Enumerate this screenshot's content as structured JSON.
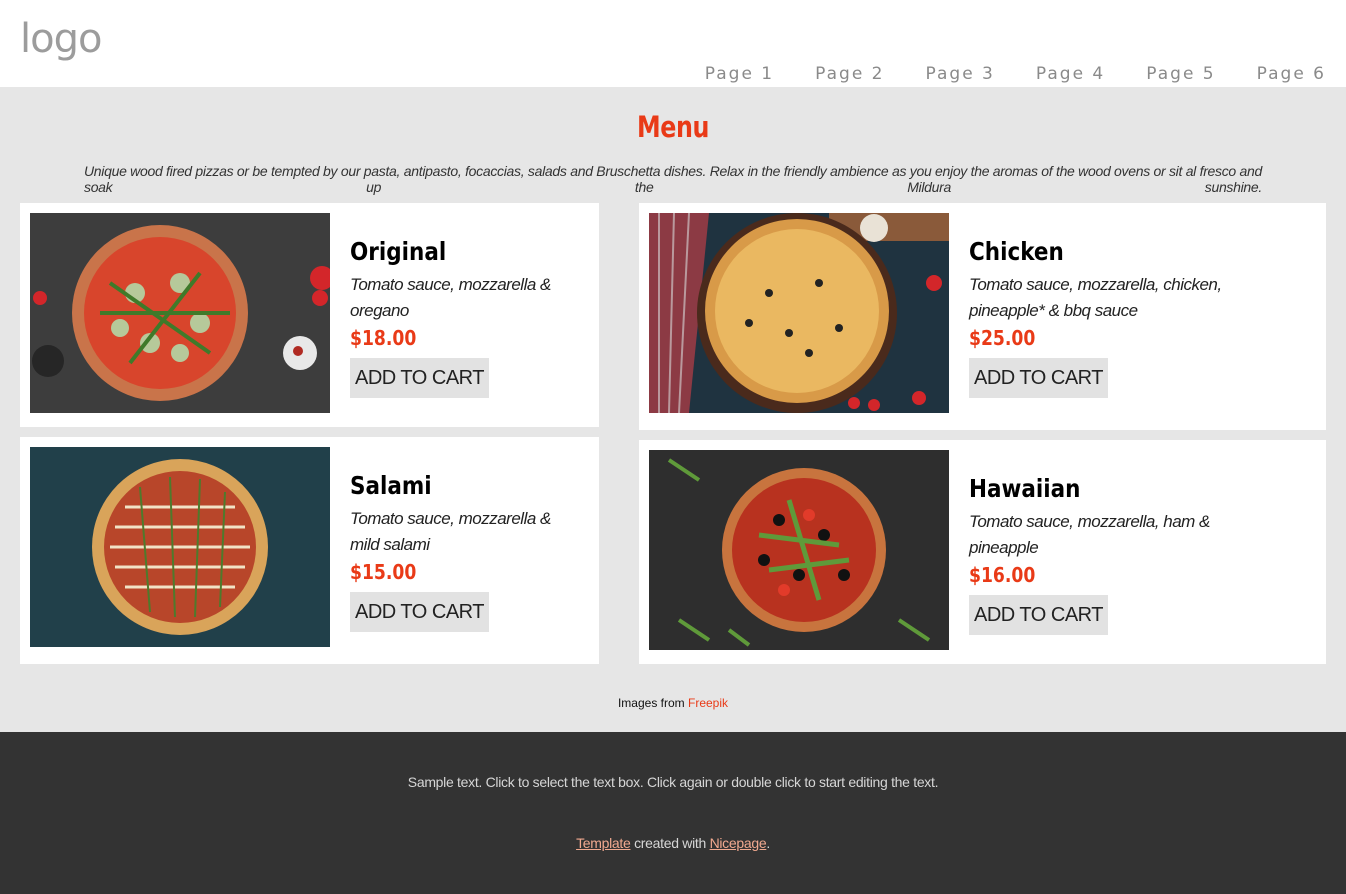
{
  "header": {
    "logo": "logo",
    "nav": [
      "Page 1",
      "Page 2",
      "Page 3",
      "Page 4",
      "Page 5",
      "Page 6"
    ]
  },
  "menu": {
    "title": "Menu",
    "intro": "Unique wood fired pizzas or be tempted by our pasta, antipasto, focaccias, salads and Bruschetta dishes. Relax in the friendly ambience as you enjoy the aromas of the wood ovens or sit al fresco and soak up the Mildura sunshine.",
    "items": [
      {
        "name": "Original",
        "description": "Tomato sauce, mozzarella & oregano",
        "price": "$18.00",
        "button": "ADD TO CART"
      },
      {
        "name": "Chicken",
        "description": "Tomato sauce, mozzarella, chicken, pineapple* & bbq sauce",
        "price": "$25.00",
        "button": "ADD TO CART"
      },
      {
        "name": "Salami",
        "description": "Tomato sauce, mozzarella & mild salami",
        "price": "$15.00",
        "button": "ADD TO CART"
      },
      {
        "name": "Hawaiian",
        "description": "Tomato sauce, mozzarella, ham & pineapple",
        "price": "$16.00",
        "button": "ADD TO CART"
      }
    ]
  },
  "credit": {
    "prefix": "Images from",
    "link": "Freepik"
  },
  "footer": {
    "sample": "Sample text. Click to select the text box. Click again or double click to start editing the text.",
    "template_link": "Template",
    "created_with": "created with",
    "nicepage_link": "Nicepage",
    "period": "."
  },
  "colors": {
    "accent": "#e93a17",
    "footer_bg": "#333333",
    "section_bg": "#e6e6e6",
    "button_bg": "#e2e2e2"
  }
}
